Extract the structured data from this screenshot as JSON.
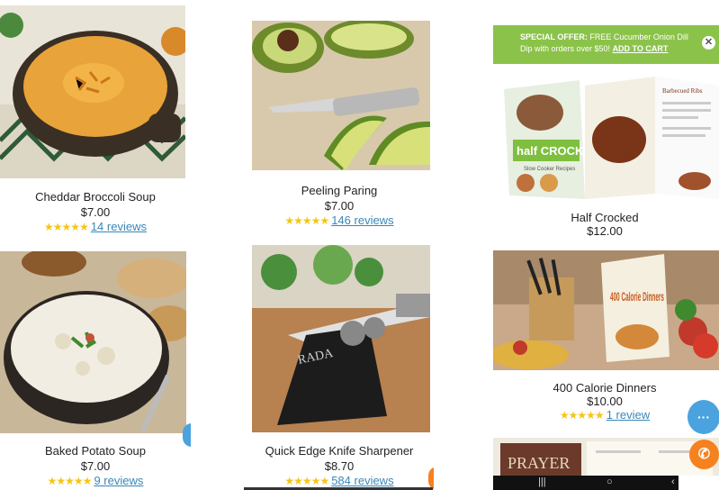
{
  "offer": {
    "label": "SPECIAL OFFER:",
    "text": "FREE Cucumber Onion Dill Dip with orders over $50!",
    "link": "ADD TO CART",
    "close": "✕"
  },
  "products": [
    {
      "title": "Cheddar Broccoli Soup",
      "price": "$7.00",
      "stars": "★★★★★",
      "reviews": "14 reviews"
    },
    {
      "title": "Peeling Paring",
      "price": "$7.00",
      "stars": "★★★★★",
      "reviews": "146 reviews"
    },
    {
      "title": "Half Crocked",
      "price": "$12.00"
    },
    {
      "title": "Baked Potato Soup",
      "price": "$7.00",
      "stars": "★★★★★",
      "reviews": "9 reviews"
    },
    {
      "title": "Quick Edge Knife Sharpener",
      "price": "$8.70",
      "stars": "★★★★★",
      "reviews": "584 reviews"
    },
    {
      "title": "400 Calorie Dinners",
      "price": "$10.00",
      "stars": "★★★★★",
      "reviews": "1 review"
    }
  ],
  "images": {
    "book_half_crocked_title": "half CROCKED",
    "book_half_crocked_sub": "Slow Cooker Recipes",
    "book_half_crocked_page": "Barbecued Ribs",
    "book_400_title": "400 Calorie Dinners",
    "book_prayer": "PRAYER",
    "sharpener_brand": "RADA"
  },
  "fabs": {
    "chat": "···",
    "phone": "✆"
  },
  "navbar": {
    "recent": "|||",
    "home": "○",
    "back": "‹"
  },
  "colors": {
    "accent_green": "#8bc34a",
    "link_blue": "#3a87b8",
    "star": "#f5c518",
    "chat": "#4aa3df",
    "phone": "#f5821f"
  }
}
